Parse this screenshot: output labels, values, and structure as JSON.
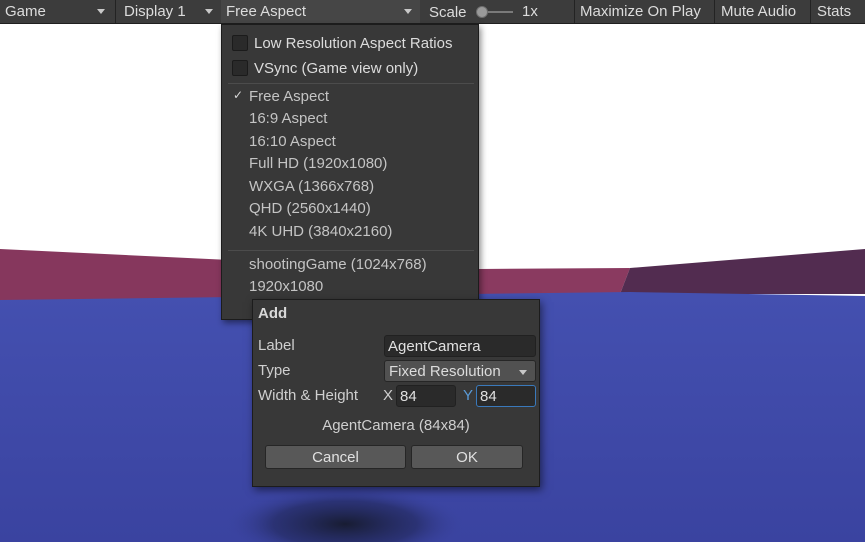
{
  "toolbar": {
    "view": "Game",
    "display": "Display 1",
    "aspect": "Free Aspect",
    "scale_label": "Scale",
    "scale_value": "1x",
    "maximize": "Maximize On Play",
    "mute": "Mute Audio",
    "stats": "Stats"
  },
  "menu": {
    "checkboxes": [
      {
        "label": "Low Resolution Aspect Ratios",
        "checked": false
      },
      {
        "label": "VSync (Game view only)",
        "checked": false
      }
    ],
    "builtin": [
      {
        "label": "Free Aspect",
        "selected": true
      },
      {
        "label": "16:9 Aspect"
      },
      {
        "label": "16:10 Aspect"
      },
      {
        "label": "Full HD (1920x1080)"
      },
      {
        "label": "WXGA (1366x768)"
      },
      {
        "label": "QHD (2560x1440)"
      },
      {
        "label": "4K UHD (3840x2160)"
      }
    ],
    "custom": [
      {
        "label": "shootingGame (1024x768)"
      },
      {
        "label": "1920x1080"
      }
    ]
  },
  "dialog": {
    "title": "Add",
    "label_label": "Label",
    "label_value": "AgentCamera",
    "type_label": "Type",
    "type_value": "Fixed Resolution",
    "size_label": "Width & Height",
    "x_label": "X",
    "x_value": "84",
    "y_label": "Y",
    "y_value": "84",
    "preview": "AgentCamera (84x84)",
    "cancel": "Cancel",
    "ok": "OK"
  },
  "colors": {
    "toolbar_bg": "#3c3c3c",
    "panel_bg": "#383838",
    "floor_blue": "#3d47a8",
    "wall_magenta": "#88385e",
    "focus_blue": "#3a79bb",
    "y_axis_label": "#5a9bd8"
  }
}
